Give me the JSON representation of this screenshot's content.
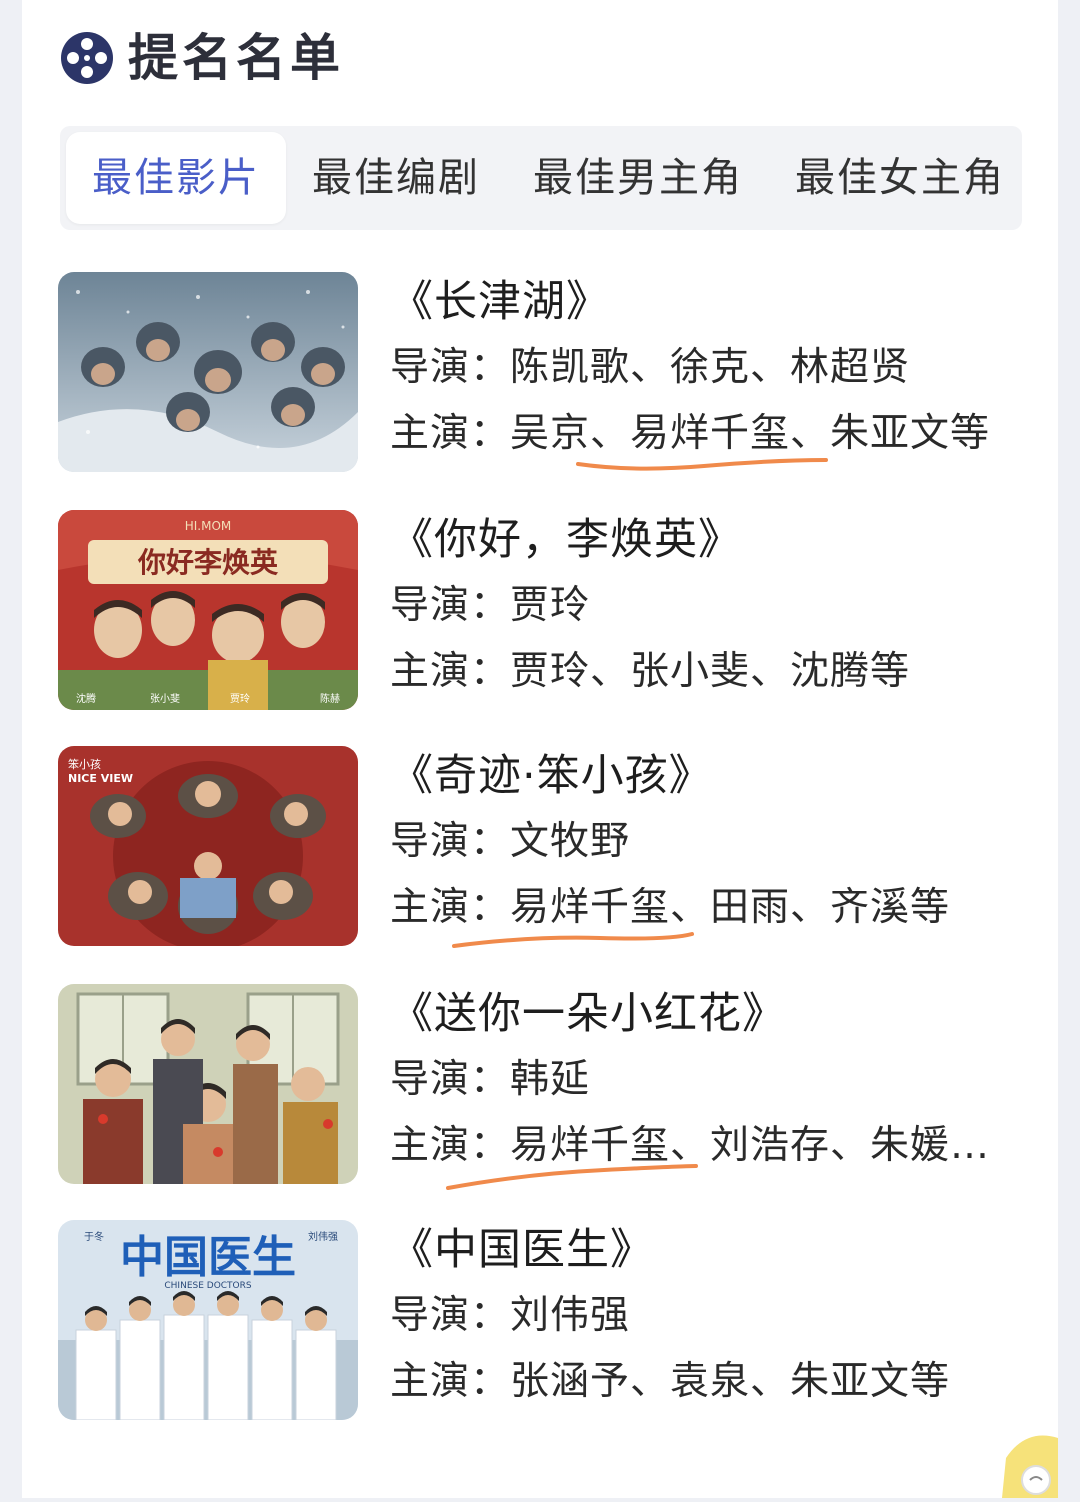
{
  "header": {
    "title": "提名名单",
    "icon": "film-reel-icon"
  },
  "tabs": [
    {
      "label": "最佳影片",
      "active": true
    },
    {
      "label": "最佳编剧",
      "active": false
    },
    {
      "label": "最佳男主角",
      "active": false
    },
    {
      "label": "最佳女主角",
      "active": false
    }
  ],
  "films": [
    {
      "title": "《长津湖》",
      "director": "导演：陈凯歌、徐克、林超贤",
      "cast": "主演：吴京、易烊千玺、朱亚文等"
    },
    {
      "title": "《你好，李焕英》",
      "director": "导演：贾玲",
      "cast": "主演：贾玲、张小斐、沈腾等",
      "poster_texts": {
        "top": "HI.MOM",
        "main": "你好李焕英",
        "n1": "沈腾",
        "n2": "张小斐",
        "n3": "贾玲",
        "n4": "陈赫"
      }
    },
    {
      "title": "《奇迹·笨小孩》",
      "director": "导演：文牧野",
      "cast": "主演：易烊千玺、田雨、齐溪等",
      "poster_texts": {
        "cn": "笨小孩",
        "en": "NICE VIEW"
      }
    },
    {
      "title": "《送你一朵小红花》",
      "director": "导演：韩延",
      "cast": "主演：易烊千玺、刘浩存、朱媛…"
    },
    {
      "title": "《中国医生》",
      "director": "导演：刘伟强",
      "cast": "主演：张涵予、袁泉、朱亚文等",
      "poster_texts": {
        "main": "中国医生",
        "en": "CHINESE DOCTORS",
        "left": "于冬",
        "right": "刘伟强"
      }
    }
  ],
  "colors": {
    "accent": "#4a5ec8",
    "highlight": "#f08a4b"
  }
}
